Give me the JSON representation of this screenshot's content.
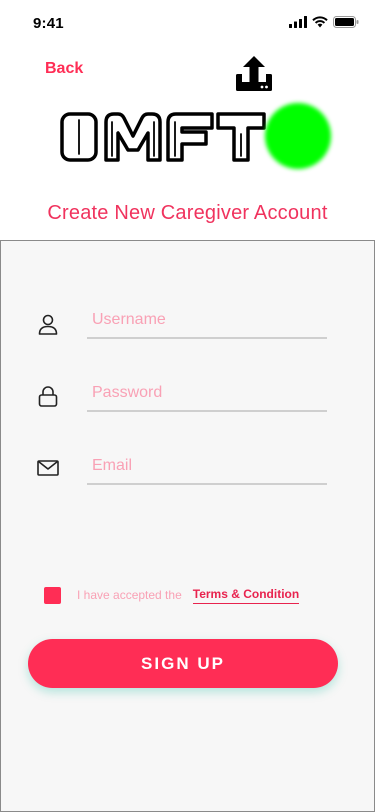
{
  "status_bar": {
    "time": "9:41"
  },
  "header": {
    "back_label": "Back"
  },
  "page_title": "Create New Caregiver Account",
  "form": {
    "username_placeholder": "Username",
    "password_placeholder": "Password",
    "email_placeholder": "Email",
    "username_value": "",
    "password_value": "",
    "email_value": "",
    "icons": [
      "user-icon",
      "lock-icon",
      "mail-icon"
    ]
  },
  "terms": {
    "prefix": "I have accepted the",
    "link": "Terms & Condition",
    "checked": true
  },
  "signup_label": "SIGN UP",
  "colors": {
    "accent": "#ff2d55",
    "placeholder": "#f9a1b5",
    "logo_dot": "#00ff00",
    "panel_bg": "#f7f7f7"
  }
}
